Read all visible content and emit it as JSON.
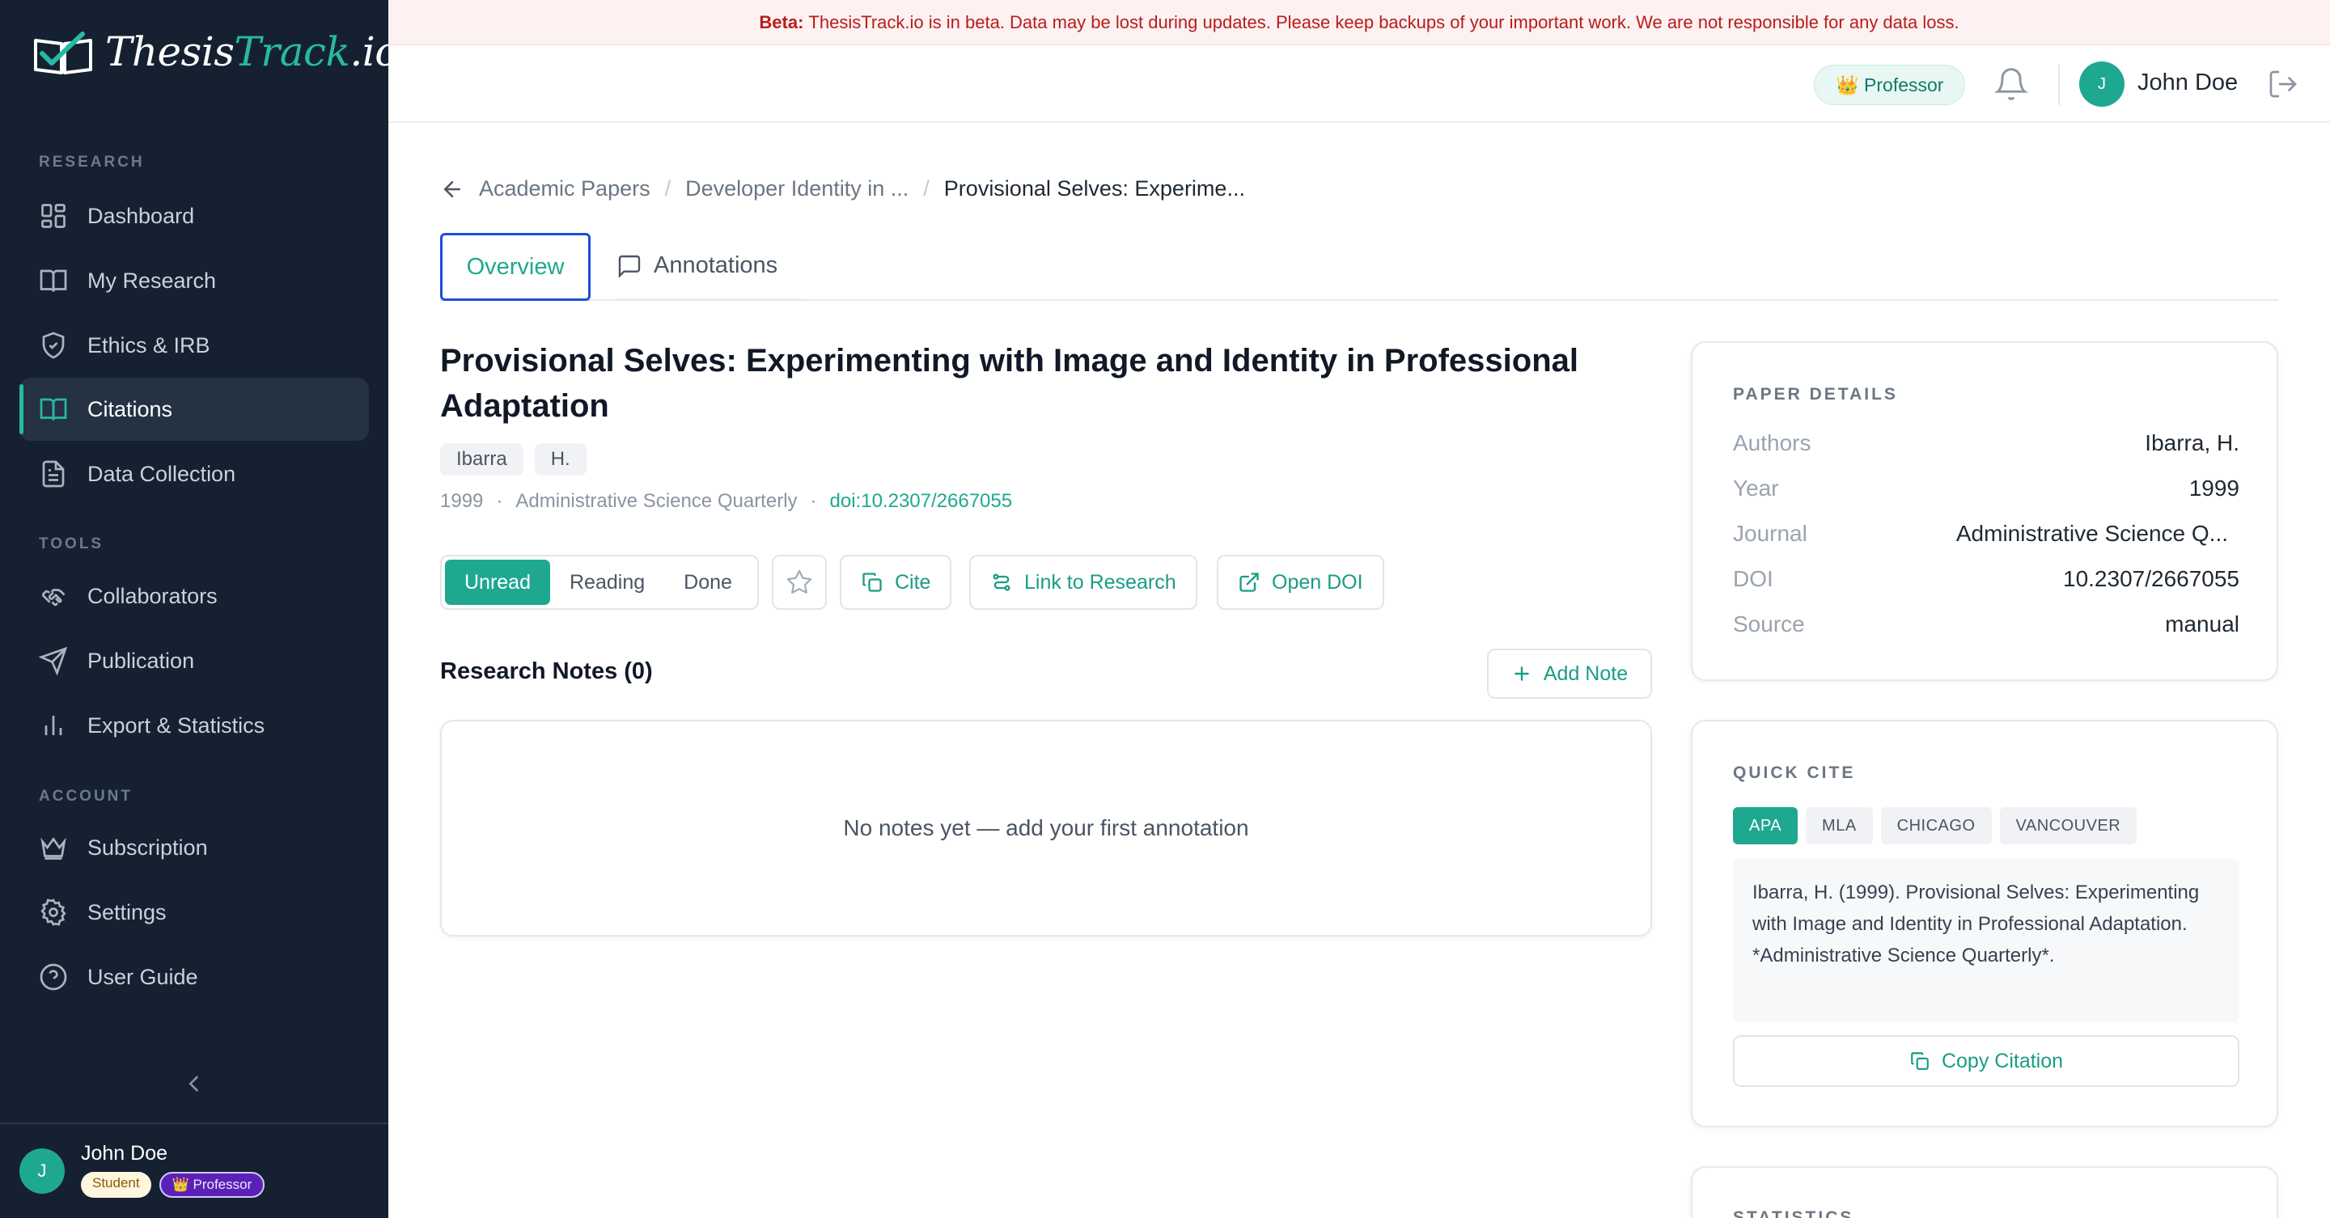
{
  "app": {
    "logo_main": "Thesis",
    "logo_accent": "Track",
    "logo_suffix": ".io"
  },
  "banner": {
    "label": "Beta:",
    "text": "ThesisTrack.io is in beta. Data may be lost during updates. Please keep backups of your important work. We are not responsible for any data loss."
  },
  "sidebar": {
    "sections": [
      "RESEARCH",
      "TOOLS",
      "ACCOUNT"
    ],
    "items": [
      {
        "label": "Dashboard",
        "icon": "dashboard-icon"
      },
      {
        "label": "My Research",
        "icon": "book-icon"
      },
      {
        "label": "Ethics & IRB",
        "icon": "shield-icon"
      },
      {
        "label": "Citations",
        "icon": "book-open-icon",
        "active": true
      },
      {
        "label": "Data Collection",
        "icon": "document-icon"
      },
      {
        "label": "Collaborators",
        "icon": "handshake-icon"
      },
      {
        "label": "Publication",
        "icon": "send-icon"
      },
      {
        "label": "Export & Statistics",
        "icon": "bar-chart-icon"
      },
      {
        "label": "Subscription",
        "icon": "crown-icon"
      },
      {
        "label": "Settings",
        "icon": "gear-icon"
      },
      {
        "label": "User Guide",
        "icon": "help-circle-icon"
      }
    ],
    "user": {
      "initial": "J",
      "name": "John Doe",
      "badge_student": "Student",
      "badge_professor": "👑 Professor"
    }
  },
  "header": {
    "role_pill": "👑 Professor",
    "avatar_initial": "J",
    "user_name": "John Doe"
  },
  "breadcrumb": {
    "items": [
      "Academic Papers",
      "Developer Identity in ...",
      "Provisional Selves: Experime..."
    ]
  },
  "tabs": {
    "overview": "Overview",
    "annotations": "Annotations"
  },
  "paper": {
    "title": "Provisional Selves: Experimenting with Image and Identity in Professional Adaptation",
    "author_chips": [
      "Ibarra",
      "H."
    ],
    "year": "1999",
    "journal": "Administrative Science Quarterly",
    "doi_link": "doi:10.2307/2667055"
  },
  "actions": {
    "status_options": [
      "Unread",
      "Reading",
      "Done"
    ],
    "status_selected": "Unread",
    "cite": "Cite",
    "link": "Link to Research",
    "open_doi": "Open DOI"
  },
  "notes": {
    "title": "Research Notes (0)",
    "add": "Add Note",
    "empty": "No notes yet — add your first annotation"
  },
  "details": {
    "heading": "PAPER DETAILS",
    "rows": [
      {
        "key": "Authors",
        "value": "Ibarra, H."
      },
      {
        "key": "Year",
        "value": "1999"
      },
      {
        "key": "Journal",
        "value": "Administrative Science Q..."
      },
      {
        "key": "DOI",
        "value": "10.2307/2667055"
      },
      {
        "key": "Source",
        "value": "manual"
      }
    ]
  },
  "quick_cite": {
    "heading": "QUICK CITE",
    "styles": [
      "APA",
      "MLA",
      "CHICAGO",
      "VANCOUVER"
    ],
    "selected": "APA",
    "text": "Ibarra, H. (1999). Provisional Selves: Experimenting with Image and Identity in Professional Adaptation. *Administrative Science Quarterly*.",
    "copy": "Copy Citation"
  },
  "stats_panel": {
    "heading": "STATISTICS"
  },
  "colors": {
    "accent": "#1fa890",
    "sidebar_bg": "#152131",
    "banner_text": "#b91c1c",
    "focus_ring": "#1d4ed8"
  }
}
